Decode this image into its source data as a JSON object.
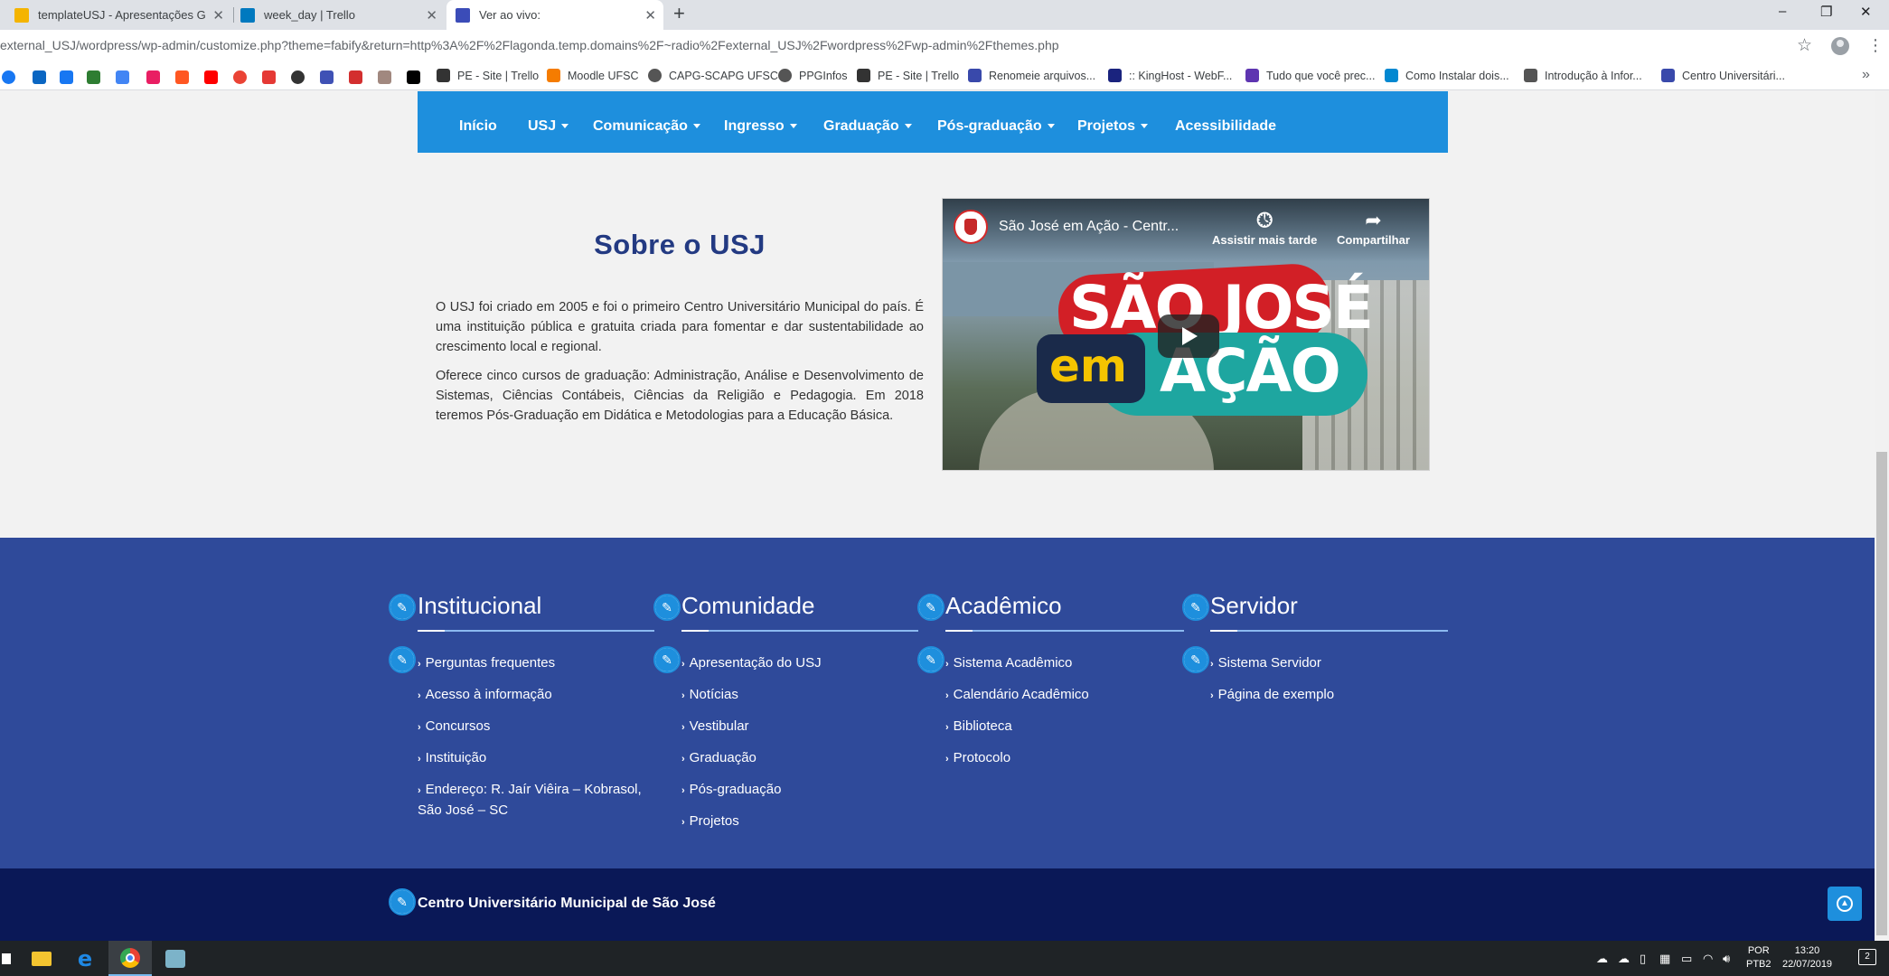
{
  "browser": {
    "tabs": [
      {
        "title": "templateUSJ - Apresentações Go",
        "color": "#f4b400"
      },
      {
        "title": "week_day | Trello",
        "color": "#0079bf"
      },
      {
        "title": "Ver ao vivo:",
        "color": "#3b4cb8"
      }
    ],
    "new_tab": "+",
    "window_controls": [
      "–",
      "❐",
      "✕"
    ],
    "url": "external_USJ/wordpress/wp-admin/customize.php?theme=fabify&return=http%3A%2F%2Flagonda.temp.domains%2F~radio%2Fexternal_USJ%2Fwordpress%2Fwp-admin%2Fthemes.php",
    "bookmark_icons": [
      "#1877f2",
      "#0a66c2",
      "#1877f2",
      "#2e7d32",
      "#4285f4",
      "#e91e63",
      "#ff5722",
      "#ff0000",
      "#ea4335",
      "#e53935",
      "#333333",
      "#3f51b5",
      "#d32f2f",
      "#a1887f",
      "#000000"
    ],
    "bookmarks": [
      {
        "label": "PE - Site | Trello",
        "color": "#333333"
      },
      {
        "label": "Moodle UFSC",
        "color": "#f57c00"
      },
      {
        "label": "CAPG-SCAPG UFSC",
        "color": "#555555"
      },
      {
        "label": "PPGInfos",
        "color": "#555555"
      },
      {
        "label": "PE - Site | Trello",
        "color": "#333333"
      },
      {
        "label": "Renomeie arquivos...",
        "color": "#3949ab"
      },
      {
        "label": ":: KingHost - WebF...",
        "color": "#1a237e"
      },
      {
        "label": "Tudo que você prec...",
        "color": "#5e35b1"
      },
      {
        "label": "Como Instalar dois...",
        "color": "#0288d1"
      },
      {
        "label": "Introdução à Infor...",
        "color": "#555555"
      },
      {
        "label": "Centro Universitári...",
        "color": "#3949ab"
      }
    ],
    "bookmarks_more": "»"
  },
  "nav": {
    "items": [
      {
        "label": "Início",
        "dropdown": false
      },
      {
        "label": "USJ",
        "dropdown": true
      },
      {
        "label": "Comunicação",
        "dropdown": true
      },
      {
        "label": "Ingresso",
        "dropdown": true
      },
      {
        "label": "Graduação",
        "dropdown": true
      },
      {
        "label": "Pós-graduação",
        "dropdown": true
      },
      {
        "label": "Projetos",
        "dropdown": true
      },
      {
        "label": "Acessibilidade",
        "dropdown": false
      }
    ]
  },
  "about": {
    "title": "Sobre o USJ",
    "paragraphs": [
      "O USJ foi criado em 2005 e foi o primeiro Centro Universitário Municipal do país. É uma instituição pública e gratuita criada para fomentar e dar sustentabilidade ao crescimento local e regional.",
      "Oferece cinco cursos de graduação: Administração, Análise e Desenvolvimento de Sistemas, Ciências Contábeis, Ciências da Religião e Pedagogia. Em 2018 teremos Pós-Graduação em Didática e Metodologias para a Educação Básica."
    ]
  },
  "video": {
    "title": "São José em Ação - Centr...",
    "watch_later": "Assistir mais tarde",
    "share": "Compartilhar",
    "banner_line1": "SÃO JOSÉ",
    "banner_em": "em",
    "banner_line2": "AÇÃO"
  },
  "footer": {
    "columns": [
      {
        "title": "Institucional",
        "links": [
          "Perguntas frequentes",
          "Acesso à informação",
          "Concursos",
          "Instituição",
          "Endereço: R. Jaír Viêira – Kobrasol, São José – SC"
        ]
      },
      {
        "title": "Comunidade",
        "links": [
          "Apresentação do USJ",
          "Notícias",
          "Vestibular",
          "Graduação",
          "Pós-graduação",
          "Projetos"
        ]
      },
      {
        "title": "Acadêmico",
        "links": [
          "Sistema Acadêmico",
          "Calendário Acadêmico",
          "Biblioteca",
          "Protocolo"
        ]
      },
      {
        "title": "Servidor",
        "links": [
          "Sistema Servidor",
          "Página de exemplo"
        ]
      }
    ],
    "bottom_text": "Centro Universitário Municipal de São José"
  },
  "taskbar": {
    "language": "POR",
    "layout": "PTB2",
    "time": "13:20",
    "date": "22/07/2019",
    "notifications": "2"
  },
  "colors": {
    "nav_bg": "#1e8fdd",
    "footer_bg": "#2f4a9a",
    "bottom_bg": "#0a1857",
    "title_color": "#233a82"
  }
}
